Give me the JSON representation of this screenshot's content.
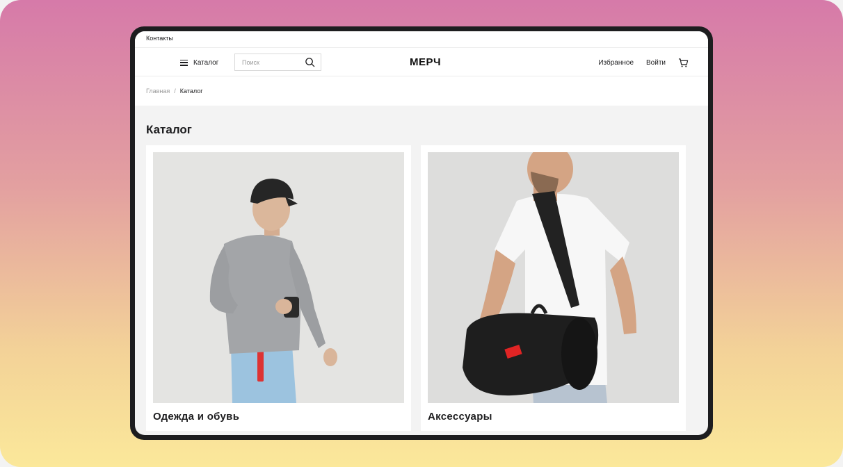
{
  "topbar": {
    "contacts": "Контакты"
  },
  "header": {
    "catalog_label": "Каталог",
    "search_placeholder": "Поиск",
    "logo": "МЕРЧ",
    "favorites": "Избранное",
    "login": "Войти"
  },
  "breadcrumb": {
    "home": "Главная",
    "separator": "/",
    "current": "Каталог"
  },
  "page_title": "Каталог",
  "categories": [
    {
      "name": "Одежда и обувь"
    },
    {
      "name": "Аксессуары"
    }
  ],
  "icons": {
    "menu": "menu-icon",
    "search": "search-icon",
    "cart": "cart-icon"
  },
  "colors": {
    "text": "#1d1d1f",
    "muted": "#9a9a9a",
    "background": "#f3f3f3",
    "card": "#ffffff"
  }
}
